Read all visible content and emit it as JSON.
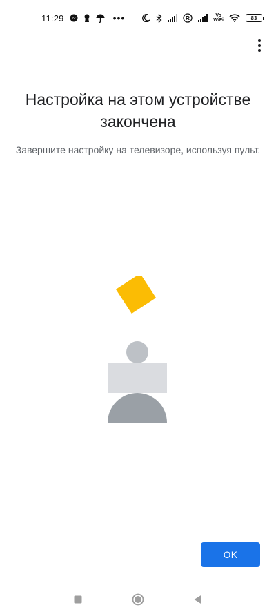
{
  "status_bar": {
    "time": "11:29",
    "left_icons": [
      "messenger-icon",
      "keyhole-icon",
      "umbrella-icon"
    ],
    "more_dots": "•••",
    "right_icons": [
      "moon-icon",
      "bluetooth-icon",
      "signal-icon",
      "roaming-icon",
      "signal-icon",
      "vowifi-icon",
      "wifi-icon"
    ],
    "vowifi_line1": "Vo",
    "vowifi_line2": "WiFi",
    "roaming_label": "R",
    "battery": "83"
  },
  "main": {
    "title": "Настройка на этом устройстве закончена",
    "subtitle": "Завершите настройку на телевизоре, используя пульт.",
    "ok_label": "OK",
    "colors": {
      "accent": "#1a73e8",
      "diamond": "#fbbc04",
      "head": "#bdc1c6",
      "body_block": "#dadce0",
      "base": "#9aa0a6"
    }
  },
  "nav_bar": {
    "icons": [
      "recents-square-icon",
      "home-circle-icon",
      "back-triangle-icon"
    ]
  }
}
